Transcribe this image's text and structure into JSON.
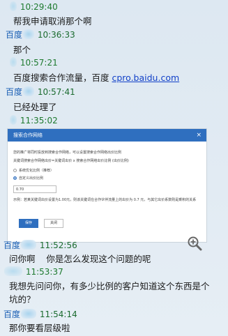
{
  "messages": [
    {
      "sender": "",
      "time": "10:29:40",
      "text": "帮我申请取消那个啊"
    },
    {
      "sender": "百度",
      "time": "10:36:33",
      "text": "那个"
    },
    {
      "sender": "",
      "time": "10:57:21",
      "text_prefix": "百度搜索合作流量，百度 ",
      "link": "cpro.baidu.com"
    },
    {
      "sender": "百度",
      "time": "10:57:41",
      "text": "已经处理了"
    },
    {
      "sender": "",
      "time": "11:35:02"
    },
    {
      "sender": "百度",
      "time": "11:52:56",
      "text": "问你啊    你是怎么发现这个问题的呢"
    },
    {
      "sender": "",
      "time": "11:53:37",
      "text_line1": "我想先问问你，有多少比例的客户知道这个东西是个",
      "text_line2": "坑的？"
    },
    {
      "sender": "百度",
      "time": "11:54:14",
      "text": "那你要看层级啦"
    }
  ],
  "dialog": {
    "title": "搜索合作网络",
    "close": "×",
    "desc": "您的推广将同时投放到搜索合作网络，可以设置搜索合作网络出价比例",
    "formula": "关键词搜索合作网络出价=关键词出价 x 搜索合作网络出价比例 (出价比例)",
    "option1": "系统优化比例（推荐）",
    "option2": "自定义出价比例",
    "value": "0.70",
    "note": "示例：若某关键词出价设置为1.00元，则该关键词在合作伙伴流量上的出价为 0.7 元，与其它出价系数则是乘积的关系",
    "save": "保存",
    "cancel": "关闭"
  },
  "icons": {
    "zoom": "zoom-in-icon"
  },
  "colors": {
    "name": "#1a5fb4",
    "time": "#1b6b2f",
    "link": "#1140c8",
    "dialog_header": "#2f6fbf"
  }
}
